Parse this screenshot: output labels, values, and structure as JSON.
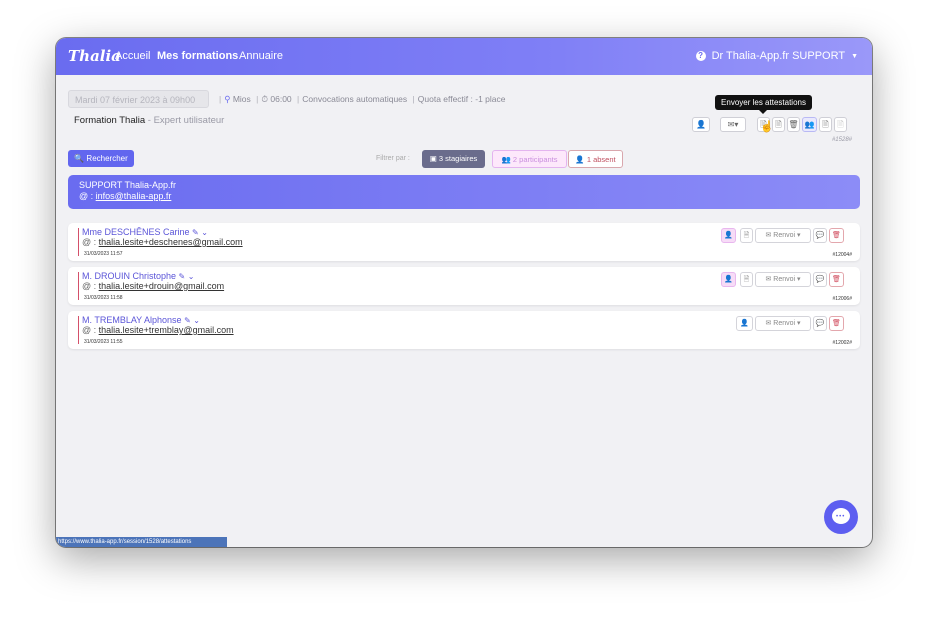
{
  "navbar": {
    "brand": "Thalia",
    "links": [
      {
        "label": "Accueil",
        "active": false
      },
      {
        "label": "Mes formations",
        "active": true
      },
      {
        "label": "Annuaire",
        "active": false
      }
    ],
    "user": "Dr Thalia-App.fr SUPPORT"
  },
  "session": {
    "date": "Mardi 07 février 2023 à 09h00",
    "location": "Mios",
    "duration": "06:00",
    "convocations": "Convocations automatiques",
    "quota": "Quota effectif : -1 place",
    "title": "Formation Thalia",
    "subtitle": "Expert utilisateur",
    "id": "#1528#"
  },
  "toolbar": {
    "tooltip": "Envoyer les attestations"
  },
  "search": {
    "label": "Rechercher"
  },
  "filters": {
    "label": "Filtrer par :",
    "stagiaires": "3 stagiaires",
    "participants": "2 participants",
    "absent": "1 absent"
  },
  "support": {
    "name": "SUPPORT Thalia-App.fr",
    "email_prefix": "@ :",
    "email": "infos@thalia-app.fr"
  },
  "participants": [
    {
      "name": "Mme DESCHÊNES Carine",
      "email": "thalia.lesite+deschenes@gmail.com",
      "date": "31/03/2023 11:57",
      "id": "#12004#",
      "renvoi": "Renvoi"
    },
    {
      "name": "M. DROUIN Christophe",
      "email": "thalia.lesite+drouin@gmail.com",
      "date": "31/03/2023 11:58",
      "id": "#12006#",
      "renvoi": "Renvoi"
    },
    {
      "name": "M. TREMBLAY Alphonse",
      "email": "thalia.lesite+tremblay@gmail.com",
      "date": "31/03/2023 11:55",
      "id": "#12002#",
      "renvoi": "Renvoi"
    }
  ],
  "statusbar": {
    "url": "https://www.thalia-app.fr/session/1528/attestations"
  },
  "colors": {
    "primary": "#6a6cf0",
    "danger": "#d04a5c",
    "pink": "#f7dcf7"
  }
}
